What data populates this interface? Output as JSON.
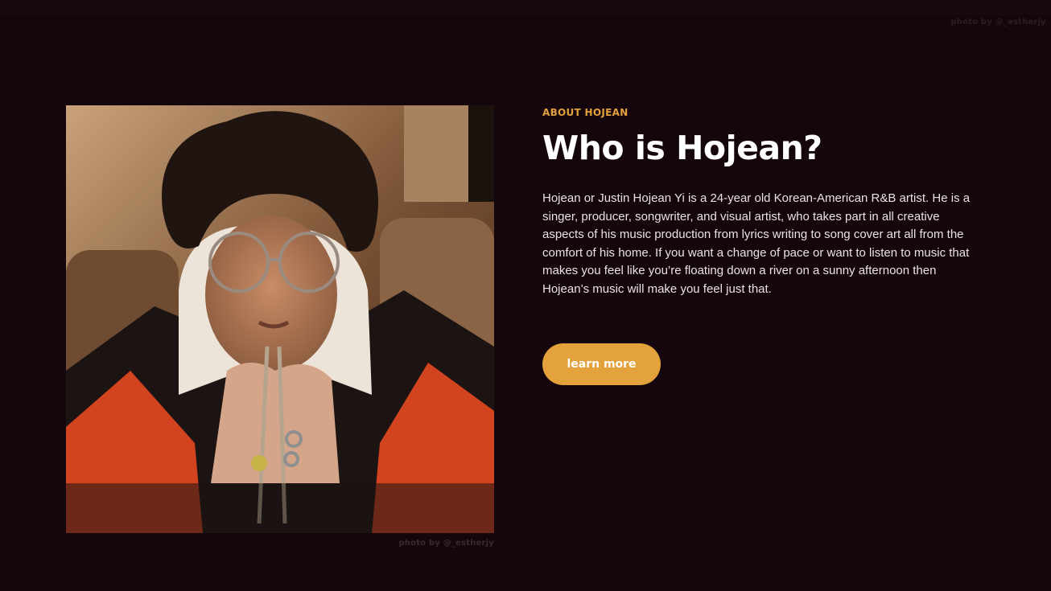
{
  "page": {
    "top_photo_credit": "photo by @_estherjy"
  },
  "about": {
    "eyebrow": "ABOUT HOJEAN",
    "heading": "Who is Hojean?",
    "bio": "Hojean or Justin Hojean Yi is a 24-year old Korean-American R&B artist. He is a singer, producer, songwriter, and visual artist, who takes part in all creative aspects of his music production from lyrics writing to song cover art all from the comfort of his home. If you want a change of pace or want to listen to music that makes you feel like you’re floating down a river on a sunny afternoon then Hojean’s music will make you feel just that.",
    "cta_label": "learn more",
    "photo_credit": "photo by @_estherjy"
  },
  "colors": {
    "background": "#14060c",
    "accent": "#e3a23c",
    "heading": "#ffffff",
    "body_text": "#e8e3e5"
  }
}
